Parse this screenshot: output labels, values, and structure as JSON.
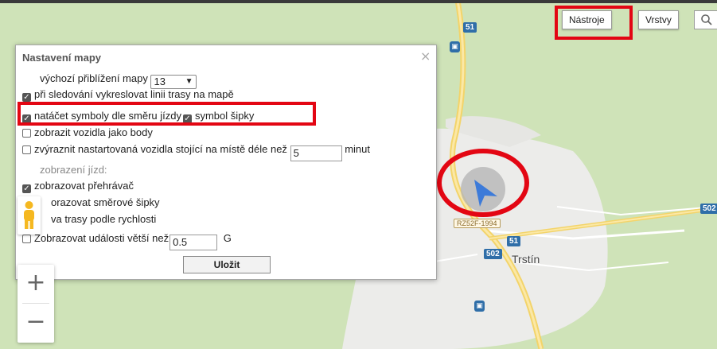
{
  "map": {
    "road_shields": [
      "51",
      "51",
      "502",
      "502"
    ],
    "town": "Trstín",
    "plate": "RZ52F-1994",
    "bus_icon": "bus-stop-icon"
  },
  "toolbar": {
    "tools_label": "Nástroje",
    "layers_label": "Vrstvy",
    "search_icon": "search-icon"
  },
  "panel": {
    "title": "Nastavení mapy",
    "close": "×",
    "zoom_label": "výchozí přiblížení mapy",
    "zoom_value": "13",
    "opt1": "při sledování vykreslovat linii trasy na mapě",
    "opt2": "natáčet symboly dle směru jízdy",
    "opt2b": "symbol šipky",
    "opt3": "zobrazit vozidla jako body",
    "opt4": "zvýraznit nastartovaná vozidla stojící na místě déle než",
    "opt4_value": "5",
    "opt4_unit": "minut",
    "section": "zobrazení jízd:",
    "opt5": "zobrazovat přehrávač",
    "opt6": "orazovat směrové šipky",
    "opt7": "va trasy podle rychlosti",
    "opt8": "Zobrazovat události větší než",
    "opt8_value": "0.5",
    "opt8_unit": "G",
    "save": "Uložit"
  },
  "zoom": {
    "plus": "+",
    "minus": "−"
  },
  "colors": {
    "highlight": "#e30613",
    "marker": "#3d7bd9",
    "panel_title": "#555555"
  }
}
